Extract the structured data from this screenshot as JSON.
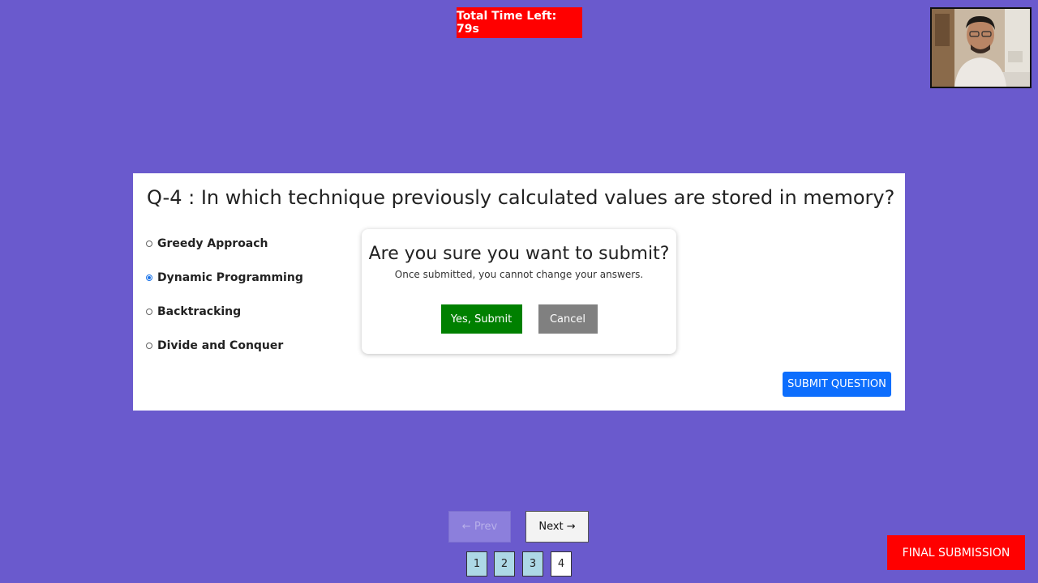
{
  "timer": {
    "text": "Total Time Left: 79s"
  },
  "question": {
    "title": "Q-4 : In which technique previously calculated values are stored in memory?",
    "options": [
      {
        "label": "Greedy Approach",
        "selected": false
      },
      {
        "label": "Dynamic Programming",
        "selected": true
      },
      {
        "label": "Backtracking",
        "selected": false
      },
      {
        "label": "Divide and Conquer",
        "selected": false
      }
    ],
    "submit_label": "SUBMIT QUESTION"
  },
  "modal": {
    "title": "Are you sure you want to submit?",
    "text": "Once submitted, you cannot change your answers.",
    "confirm_label": "Yes, Submit",
    "cancel_label": "Cancel"
  },
  "navigation": {
    "prev_label": "← Prev",
    "next_label": "Next →",
    "pages": [
      "1",
      "2",
      "3",
      "4"
    ],
    "current_page": "4"
  },
  "final_submission_label": "FINAL SUBMISSION",
  "colors": {
    "background": "#6a5acd",
    "timer": "#ff0000",
    "confirm": "#008000",
    "cancel": "#808080",
    "submit_question": "#0d6efd",
    "final_submission": "#ff0000",
    "page_visited": "#add8e6"
  }
}
